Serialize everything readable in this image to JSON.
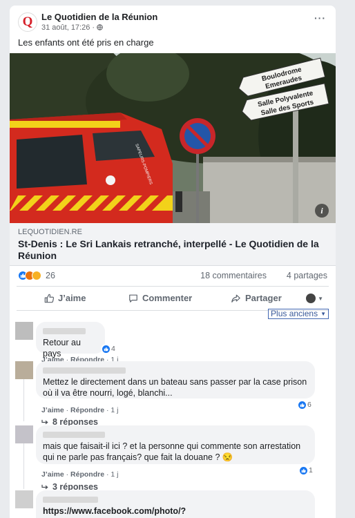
{
  "post": {
    "page_name": "Le Quotidien de la Réunion",
    "logo_letter": "Q",
    "date": "31 août, 17:26 ·",
    "text": "Les enfants ont été pris en charge",
    "more_label": "···",
    "photo_signs": {
      "sign1_line1": "Boulodrome",
      "sign1_line2": "Emeraudes",
      "sign2_line1": "Salle Polyvalente",
      "sign2_line2": "Salle des Sports",
      "truck_text": "SAPEURS-POMPIERS"
    },
    "photo_info": "i",
    "link_domain": "LEQUOTIDIEN.RE",
    "link_title": "St-Denis : Le Sri Lankais retranché, interpellé - Le Quotidien de la Réunion"
  },
  "stats": {
    "reactions_count": "26",
    "comments": "18 commentaires",
    "shares": "4 partages"
  },
  "actions": {
    "like": "J’aime",
    "comment": "Commenter",
    "share": "Partager"
  },
  "sort": {
    "label": "Plus anciens"
  },
  "comments": [
    {
      "text": "Retour au pays",
      "reactions": "4",
      "like": "J’aime",
      "reply": "Répondre",
      "time": "1 j"
    },
    {
      "text": "Mettez le directement dans un bateau sans passer par la case prison où il va être nourri, logé, blanchi...",
      "reactions": "6",
      "like": "J’aime",
      "reply": "Répondre",
      "time": "1 j",
      "replies": "8 réponses"
    },
    {
      "text": "mais que faisait-il ici ? et la personne qui commente son arrestation qui ne parle pas français? que fait la douane ? 😒",
      "reactions": "1",
      "like": "J’aime",
      "reply": "Répondre",
      "time": "1 j",
      "replies": "3 réponses"
    },
    {
      "text": "https://www.facebook.com/photo/?"
    }
  ],
  "colors": {
    "accent": "#1877f2",
    "link": "#385898",
    "background": "#e9ebee",
    "brand_red": "#d6202a"
  }
}
